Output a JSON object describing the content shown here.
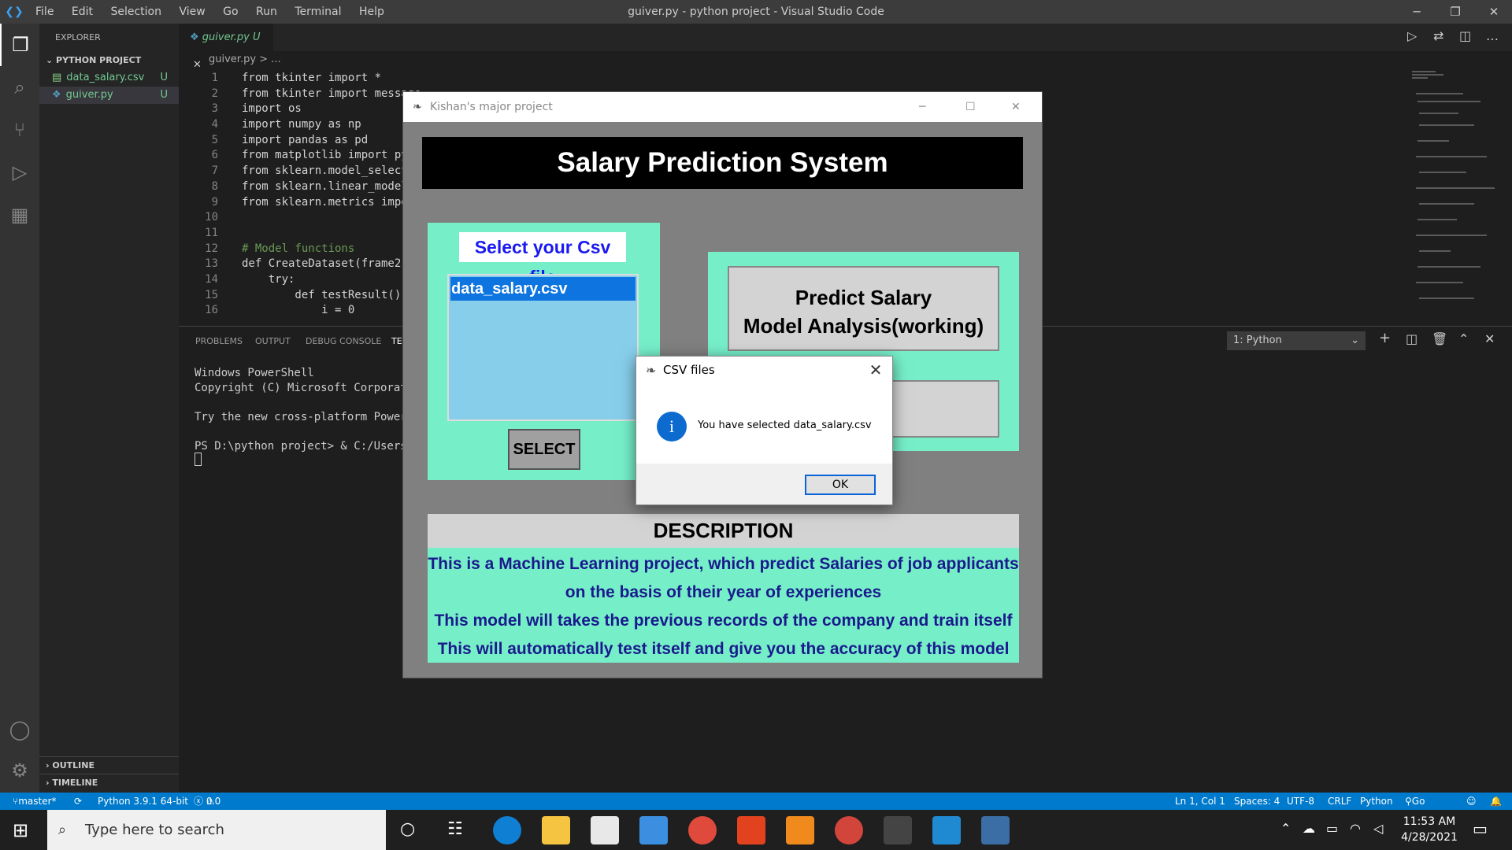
{
  "vscode": {
    "menu": [
      "File",
      "Edit",
      "Selection",
      "View",
      "Go",
      "Run",
      "Terminal",
      "Help"
    ],
    "window_title": "guiver.py - python project - Visual Studio Code",
    "explorer": {
      "header": "EXPLORER",
      "section": "PYTHON PROJECT",
      "files": [
        {
          "name": "data_salary.csv",
          "badge": "U"
        },
        {
          "name": "guiver.py",
          "badge": "U"
        }
      ],
      "outline": "OUTLINE",
      "timeline": "TIMELINE"
    },
    "tab": {
      "label": "guiver.py",
      "badge": "U"
    },
    "breadcrumb": "guiver.py > ...",
    "code_lines": [
      "from tkinter import *",
      "from tkinter import message",
      "import os",
      "import numpy as np",
      "import pandas as pd",
      "from matplotlib import pypl",
      "from sklearn.model_selectio",
      "from sklearn.linear_model i",
      "from sklearn.metrics import",
      "",
      "",
      "# Model functions",
      "def CreateDataset(frame2,fr",
      "    try:",
      "        def testResult():",
      "            i = 0"
    ],
    "panel_tabs": [
      "PROBLEMS",
      "OUTPUT",
      "DEBUG CONSOLE",
      "TE"
    ],
    "terminal_lines": [
      "Windows PowerShell",
      "Copyright (C) Microsoft Corporati",
      "",
      "Try the new cross-platform PowerS",
      "",
      "PS D:\\python project> & C:/Users/"
    ],
    "terminal_select": "1: Python",
    "status": {
      "branch": "master*",
      "python": "Python 3.9.1 64-bit",
      "errors": "0",
      "warnings": "0",
      "position": "Ln 1, Col 1",
      "spaces": "Spaces: 4",
      "encoding": "UTF-8",
      "eol": "CRLF",
      "language": "Python",
      "golive": "Go Live"
    }
  },
  "tk_app": {
    "window_title": "Kishan's major project",
    "heading": "Salary Prediction System",
    "select_label": "Select your Csv file",
    "listbox_items": [
      "data_salary.csv"
    ],
    "select_button": "SELECT",
    "predict_button_line1": "Predict Salary",
    "predict_button_line2": "Model Analysis(working)",
    "description_heading": "DESCRIPTION",
    "description_lines": [
      "This is a Machine Learning project, which predict  Salaries of job applicants",
      "on the basis of their year of experiences",
      "This model will takes the previous records of the company and train itself",
      "This will automatically test itself and give you the accuracy of this model"
    ]
  },
  "dialog": {
    "title": "CSV files",
    "message": "You have selected data_salary.csv",
    "ok": "OK"
  },
  "taskbar": {
    "search_placeholder": "Type here to search",
    "time": "11:53 AM",
    "date": "4/28/2021"
  },
  "colors": {
    "accent": "#007acc",
    "mint": "#76efc9",
    "list_bg": "#87ceeb",
    "selection": "#0d74e0",
    "desc_text": "#1a1a8c"
  }
}
